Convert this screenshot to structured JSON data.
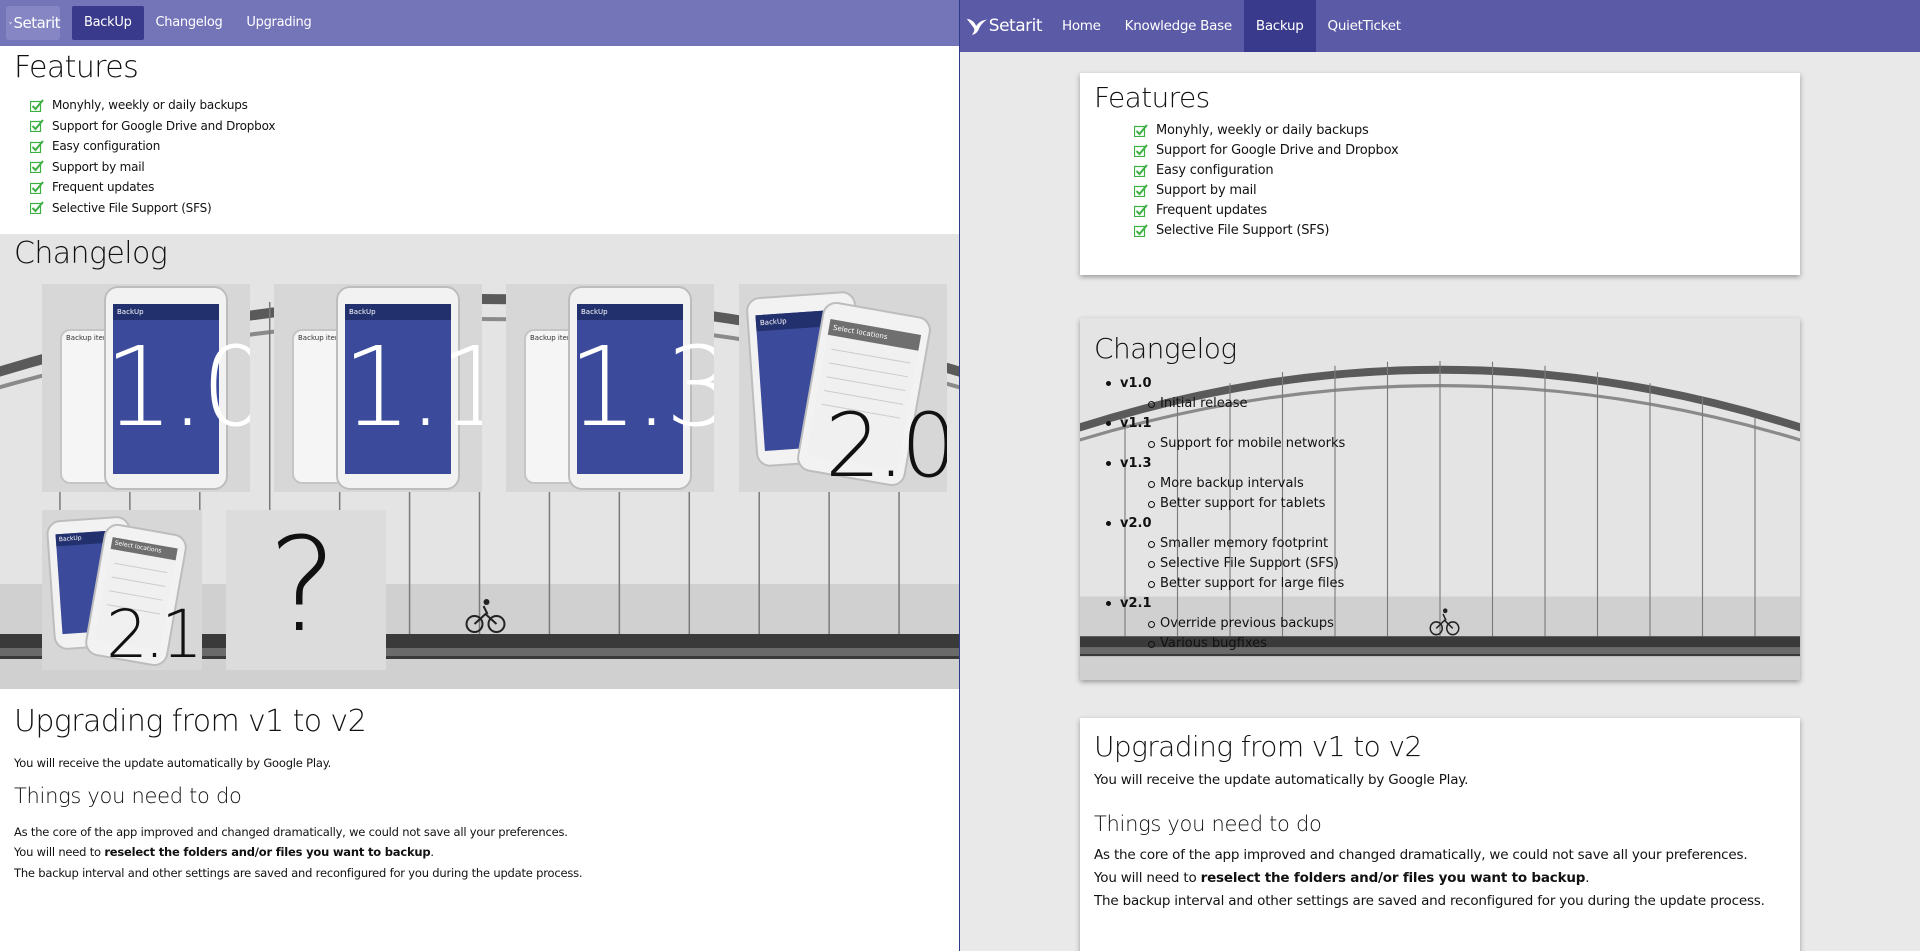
{
  "brand": {
    "name": "Setarit"
  },
  "left": {
    "nav": [
      "BackUp",
      "Changelog",
      "Upgrading"
    ],
    "features_title": "Features",
    "features": [
      "Monyhly, weekly or daily backups",
      "Support for Google Drive and Dropbox",
      "Easy configuration",
      "Support by mail",
      "Frequent updates",
      "Selective File Support (SFS)"
    ],
    "changelog_title": "Changelog",
    "tiles": [
      "1.0",
      "1.1",
      "1.3",
      "2.0",
      "2.1",
      "?"
    ],
    "phone": {
      "app_title": "BackUp",
      "back_title": "Backup items",
      "logo_text": "BackUp",
      "select_title": "Select locations",
      "items": [
        "Text messages",
        "Contacts",
        "Documents",
        "Pictures",
        "Music",
        "Movies",
        "Complete"
      ]
    },
    "upgrade_title": "Upgrading from v1 to v2",
    "upgrade_text": "You will receive the update automatically by Google Play.",
    "things_title": "Things you need to do",
    "p1": "As the core of the app improved and changed dramatically, we could not save all your preferences.",
    "p2_pre": "You will need to ",
    "p2_bold": "reselect the folders and/or files you want to backup",
    "p2_post": ".",
    "p3": "The backup interval and other settings are saved and reconfigured for you during the update process."
  },
  "right": {
    "nav": [
      "Home",
      "Knowledge Base",
      "Backup",
      "QuietTicket"
    ],
    "features_title": "Features",
    "features": [
      "Monyhly, weekly or daily backups",
      "Support for Google Drive and Dropbox",
      "Easy configuration",
      "Support by mail",
      "Frequent updates",
      "Selective File Support (SFS)"
    ],
    "changelog_title": "Changelog",
    "versions": [
      {
        "label": "v1.0",
        "items": [
          "Initial release"
        ]
      },
      {
        "label": "v1.1",
        "items": [
          "Support for mobile networks"
        ]
      },
      {
        "label": "v1.3",
        "items": [
          "More backup intervals",
          "Better support for tablets"
        ]
      },
      {
        "label": "v2.0",
        "items": [
          "Smaller memory footprint",
          "Selective File Support (SFS)",
          "Better support for large files"
        ]
      },
      {
        "label": "v2.1",
        "items": [
          "Override previous backups",
          "Various bugfixes"
        ]
      }
    ],
    "upgrade_title": "Upgrading from v1 to v2",
    "upgrade_text": "You will receive the update automatically by Google Play.",
    "things_title": "Things you need to do",
    "p1": "As the core of the app improved and changed dramatically, we could not save all your preferences.",
    "p2_pre": "You will need to ",
    "p2_bold": "reselect the folders and/or files you want to backup",
    "p2_post": ".",
    "p3": "The backup interval and other settings are saved and reconfigured for you during the update process."
  },
  "colors": {
    "nav_left": "#7474b8",
    "nav_right": "#5a5aa6",
    "nav_active": "#3a3a8c",
    "check": "#3cb043"
  }
}
